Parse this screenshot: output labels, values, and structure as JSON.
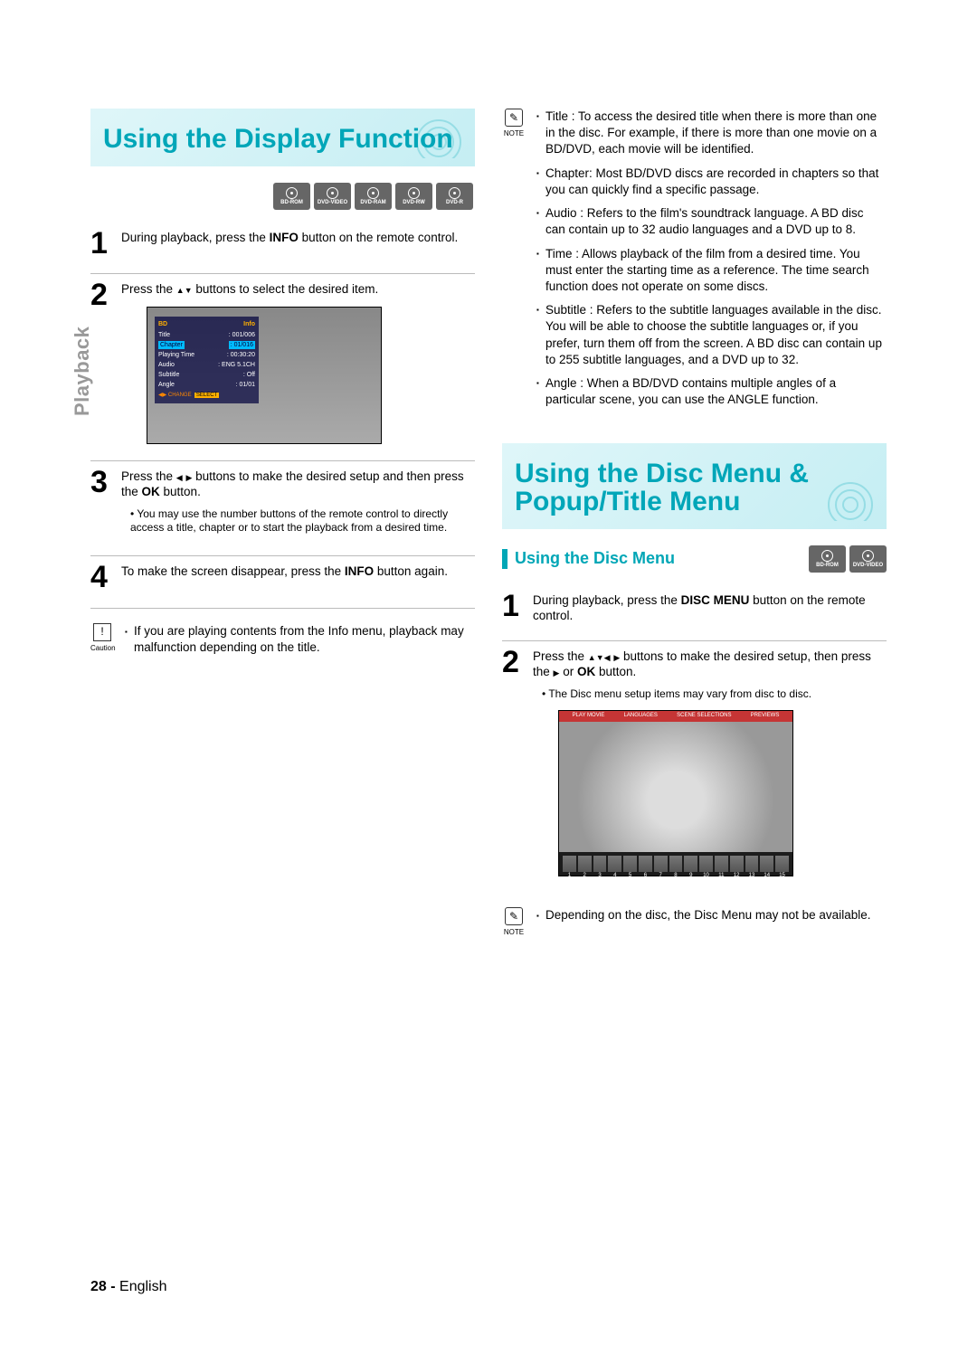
{
  "sideTab": "Playback",
  "footer": {
    "page": "28 -",
    "lang": "English"
  },
  "formats": [
    "BD-ROM",
    "DVD-VIDEO",
    "DVD-RAM",
    "DVD-RW",
    "DVD-R"
  ],
  "formats2": [
    "BD-ROM",
    "DVD-VIDEO"
  ],
  "section1": {
    "title": "Using the Display Function",
    "step1_a": "During playback, press the ",
    "step1_b": "INFO",
    "step1_c": " button on the remote control.",
    "step2_a": "Press the ",
    "step2_b": " buttons to select the desired item.",
    "overlay": {
      "hdrL": "BD",
      "hdrR": "Info",
      "rows": [
        [
          "Title",
          ": 001/006"
        ],
        [
          "Chapter",
          ": 01/016"
        ],
        [
          "Playing Time",
          ": 00:30:20"
        ],
        [
          "Audio",
          ": ENG 5.1CH"
        ],
        [
          "Subtitle",
          ": Off"
        ],
        [
          "Angle",
          ": 01/01"
        ]
      ],
      "btmL": "◀▶ CHANGE",
      "btmR": "SELECT"
    },
    "step3_a": "Press the ",
    "step3_b": " buttons to make the desired setup and then press the ",
    "step3_ok": "OK",
    "step3_c": " button.",
    "step3_sub": "You may use the number buttons of the remote control to directly access a title, chapter or to start the playback from a desired time.",
    "step4_a": "To make the screen disappear, press the ",
    "step4_b": "INFO",
    "step4_c": " button again.",
    "cautionLabel": "Caution",
    "cautionText": "If you are playing contents from the Info menu, playback may malfunction depending on the title."
  },
  "notes": {
    "label": "NOTE",
    "items": [
      "Title : To access the desired title when there is more than one in the disc. For example, if there is more than one movie on a BD/DVD, each movie will be identified.",
      "Chapter: Most BD/DVD discs are recorded in chapters so that you can quickly find a specific passage.",
      "Audio : Refers to the film's soundtrack language. A BD disc can contain up to 32 audio languages and a DVD up to 8.",
      "Time : Allows playback of the film from a desired time. You must enter the starting time as a reference. The time search function does not operate on some discs.",
      "Subtitle : Refers to the subtitle languages available in the disc. You will be able to choose the subtitle languages or, if you prefer, turn them off from the screen. A BD disc can contain up to 255 subtitle languages, and a DVD up to 32.",
      "Angle : When a BD/DVD contains multiple angles of a particular scene, you can use the ANGLE function."
    ]
  },
  "section2": {
    "title": "Using the Disc Menu & Popup/Title Menu",
    "subhead": "Using the Disc Menu",
    "step1_a": "During playback, press the ",
    "step1_b": "DISC MENU",
    "step1_c": " button on the remote control.",
    "step2_a": "Press the ",
    "step2_b": " buttons to make the desired setup, then press the ",
    "step2_c": " or ",
    "step2_ok": "OK",
    "step2_d": " button.",
    "step2_sub": "The Disc menu setup items may vary from disc to disc.",
    "menuItems": [
      "PLAY MOVIE",
      "LANGUAGES",
      "SCENE SELECTIONS",
      "PREVIEWS"
    ],
    "chapters": [
      "1",
      "2",
      "3",
      "4",
      "5",
      "6",
      "7",
      "8",
      "9",
      "10",
      "11",
      "12",
      "13",
      "14",
      "15"
    ],
    "noteLabel": "NOTE",
    "noteText": "Depending on the disc, the Disc Menu may not be available."
  }
}
